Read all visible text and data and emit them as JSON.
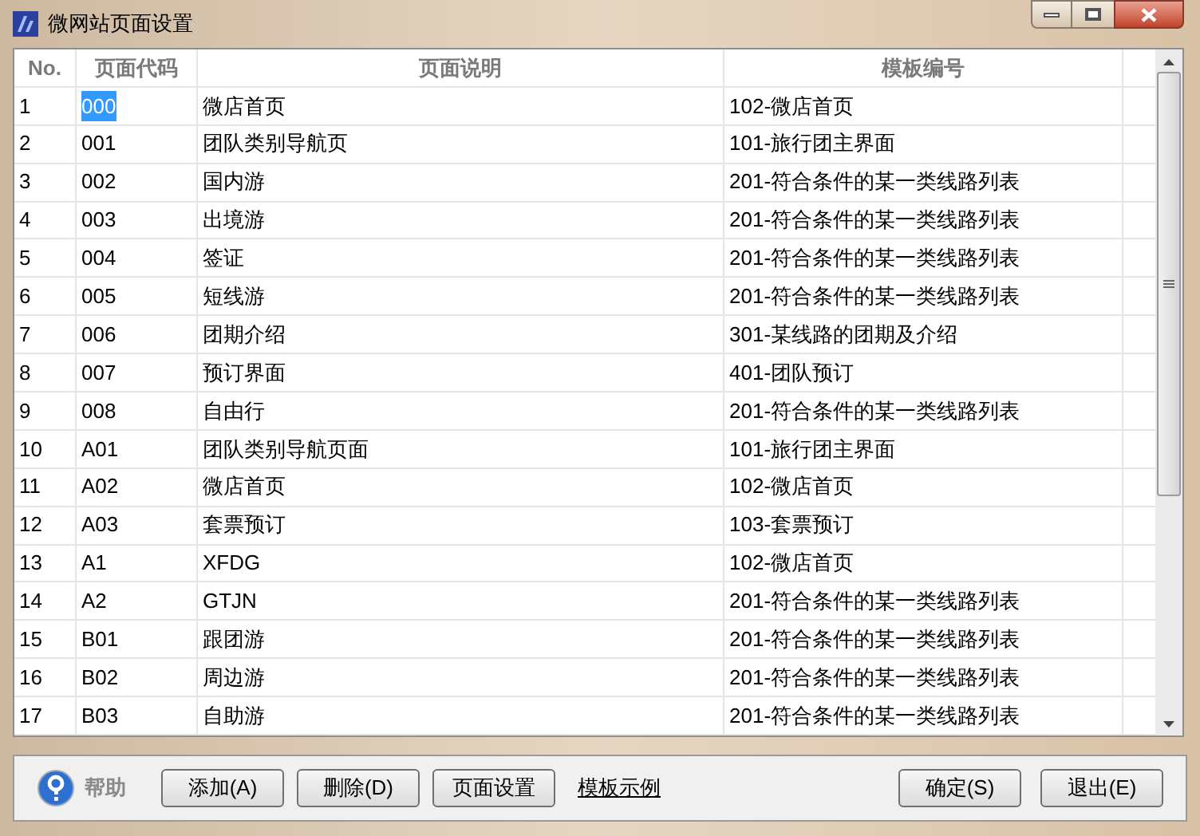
{
  "window": {
    "title": "微网站页面设置"
  },
  "table": {
    "columns": [
      "No.",
      "页面代码",
      "页面说明",
      "模板编号"
    ],
    "rows": [
      {
        "no": "1",
        "code": "000",
        "description": "微店首页",
        "template": "102-微店首页",
        "selected": true
      },
      {
        "no": "2",
        "code": "001",
        "description": "团队类别导航页",
        "template": "101-旅行团主界面",
        "selected": false
      },
      {
        "no": "3",
        "code": "002",
        "description": "国内游",
        "template": "201-符合条件的某一类线路列表",
        "selected": false
      },
      {
        "no": "4",
        "code": "003",
        "description": "出境游",
        "template": "201-符合条件的某一类线路列表",
        "selected": false
      },
      {
        "no": "5",
        "code": "004",
        "description": "签证",
        "template": "201-符合条件的某一类线路列表",
        "selected": false
      },
      {
        "no": "6",
        "code": "005",
        "description": "短线游",
        "template": "201-符合条件的某一类线路列表",
        "selected": false
      },
      {
        "no": "7",
        "code": "006",
        "description": "团期介绍",
        "template": "301-某线路的团期及介绍",
        "selected": false
      },
      {
        "no": "8",
        "code": "007",
        "description": "预订界面",
        "template": "401-团队预订",
        "selected": false
      },
      {
        "no": "9",
        "code": "008",
        "description": "自由行",
        "template": "201-符合条件的某一类线路列表",
        "selected": false
      },
      {
        "no": "10",
        "code": "A01",
        "description": "团队类别导航页面",
        "template": "101-旅行团主界面",
        "selected": false
      },
      {
        "no": "11",
        "code": "A02",
        "description": "微店首页",
        "template": "102-微店首页",
        "selected": false
      },
      {
        "no": "12",
        "code": "A03",
        "description": "套票预订",
        "template": "103-套票预订",
        "selected": false
      },
      {
        "no": "13",
        "code": "A1",
        "description": "XFDG",
        "template": "102-微店首页",
        "selected": false
      },
      {
        "no": "14",
        "code": "A2",
        "description": "GTJN",
        "template": "201-符合条件的某一类线路列表",
        "selected": false
      },
      {
        "no": "15",
        "code": "B01",
        "description": "跟团游",
        "template": "201-符合条件的某一类线路列表",
        "selected": false
      },
      {
        "no": "16",
        "code": "B02",
        "description": "周边游",
        "template": "201-符合条件的某一类线路列表",
        "selected": false
      },
      {
        "no": "17",
        "code": "B03",
        "description": "自助游",
        "template": "201-符合条件的某一类线路列表",
        "selected": false
      }
    ]
  },
  "footer": {
    "help": "帮助",
    "buttons": [
      {
        "kind": "button",
        "label": "添加(A)"
      },
      {
        "kind": "button",
        "label": "删除(D)"
      },
      {
        "kind": "button",
        "label": "页面设置"
      },
      {
        "kind": "link",
        "label": "模板示例"
      }
    ],
    "right_buttons": [
      "确定(S)",
      "退出(E)"
    ]
  }
}
